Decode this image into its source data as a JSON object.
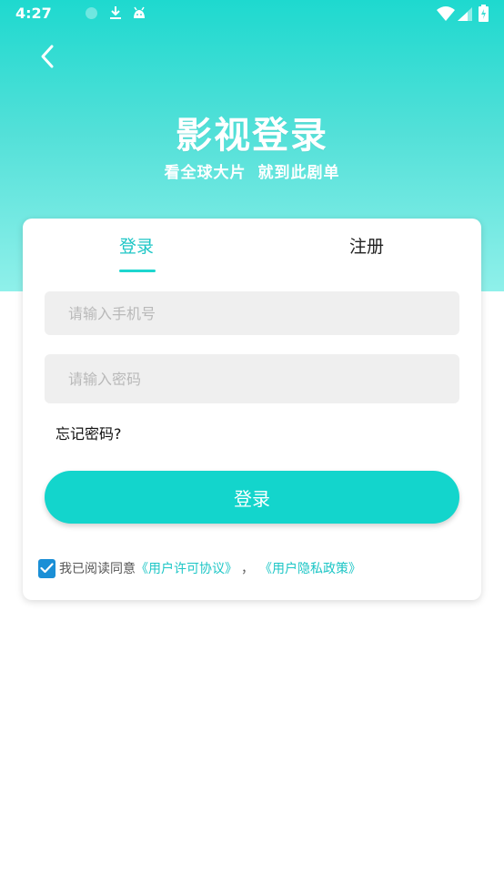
{
  "status_bar": {
    "time": "4:27"
  },
  "header": {
    "title": "影视登录",
    "subtitle": "看全球大片 就到此剧单"
  },
  "tabs": [
    {
      "label": "登录",
      "active": true
    },
    {
      "label": "注册",
      "active": false
    }
  ],
  "form": {
    "phone_placeholder": "请输入手机号",
    "phone_value": "",
    "password_placeholder": "请输入密码",
    "password_value": "",
    "forgot_label": "忘记密码?",
    "submit_label": "登录"
  },
  "agreement": {
    "checked": true,
    "prefix": "我已阅读同意",
    "terms_link": "《用户许可协议》",
    "separator": "，",
    "privacy_link": "《用户隐私政策》"
  },
  "colors": {
    "accent": "#1dc6c6",
    "button": "#13d5cc",
    "checkbox": "#1b8fd6",
    "input_bg": "#efefef"
  },
  "icons": [
    "back-arrow-icon",
    "download-icon",
    "android-icon",
    "wifi-icon",
    "signal-icon",
    "battery-icon",
    "check-icon"
  ]
}
